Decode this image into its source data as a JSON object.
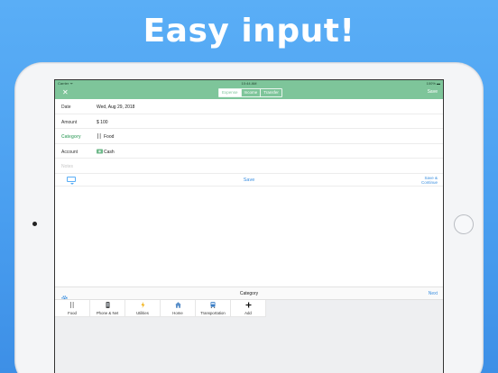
{
  "headline": "Easy input!",
  "status": {
    "carrier": "Carrier ᯤ",
    "time": "10:44 AM",
    "battery": "100% ▬"
  },
  "nav": {
    "close_symbol": "✕",
    "segments": [
      {
        "label": "Expense",
        "active": true
      },
      {
        "label": "Income",
        "active": false
      },
      {
        "label": "Transfer",
        "active": false
      }
    ],
    "save_label": "Save"
  },
  "form": {
    "date": {
      "label": "Date",
      "value": "Wed, Aug 29, 2018"
    },
    "amount": {
      "label": "Amount",
      "value": "$ 100"
    },
    "category": {
      "label": "Category",
      "value": "Food",
      "icon": "fork-knife-icon"
    },
    "account": {
      "label": "Account",
      "value": "Cash",
      "icon": "cash-icon"
    },
    "notes": {
      "placeholder": "Notes"
    }
  },
  "actions": {
    "save_label": "Save",
    "save_continue_line1": "Save &",
    "save_continue_line2": "Continue"
  },
  "category_panel": {
    "title": "Category",
    "next_label": "Next",
    "items": [
      {
        "label": "Food",
        "icon": "fork-knife-icon"
      },
      {
        "label": "Phone & Net",
        "icon": "phone-icon"
      },
      {
        "label": "Utilities",
        "icon": "lightning-icon"
      },
      {
        "label": "Home",
        "icon": "home-icon"
      },
      {
        "label": "Transportation",
        "icon": "train-icon"
      },
      {
        "label": "Add",
        "icon": "plus-icon"
      }
    ]
  },
  "colors": {
    "brand_green": "#7ec59a",
    "accent_blue": "#3a8fe0",
    "background_blue": "#4a9ff0"
  }
}
